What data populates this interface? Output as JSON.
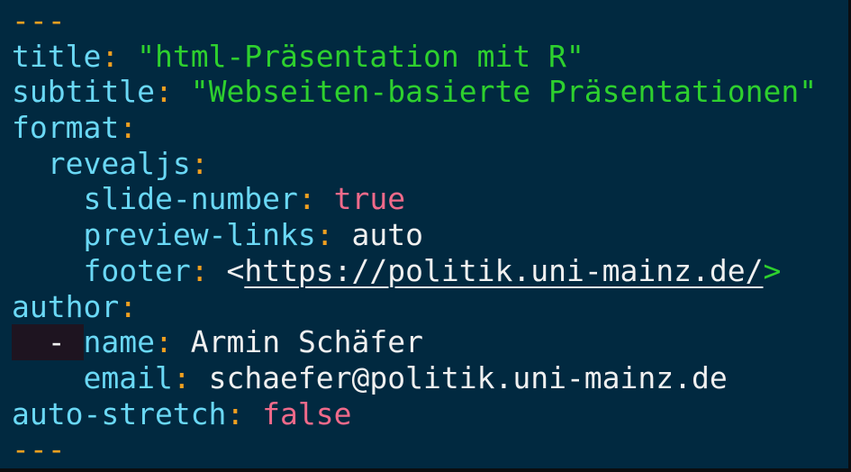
{
  "yaml": {
    "open_marker": "---",
    "close_marker": "---",
    "title_key": "title",
    "title_value": "\"html-Präsentation mit R\"",
    "subtitle_key": "subtitle",
    "subtitle_value": "\"Webseiten-basierte Präsentationen\"",
    "format_key": "format",
    "revealjs_key": "revealjs",
    "slide_number_key": "slide-number",
    "slide_number_value": "true",
    "preview_links_key": "preview-links",
    "preview_links_value": "auto",
    "footer_key": "footer",
    "footer_open": "<",
    "footer_url": "https://politik.uni-mainz.de/",
    "footer_close": ">",
    "author_key": "author",
    "list_dash": "-",
    "name_key": "name",
    "name_value": "Armin Schäfer",
    "email_key": "email",
    "email_value": "schaefer@politik.uni-mainz.de",
    "auto_stretch_key": "auto-stretch",
    "auto_stretch_value": "false",
    "colon": ":"
  }
}
